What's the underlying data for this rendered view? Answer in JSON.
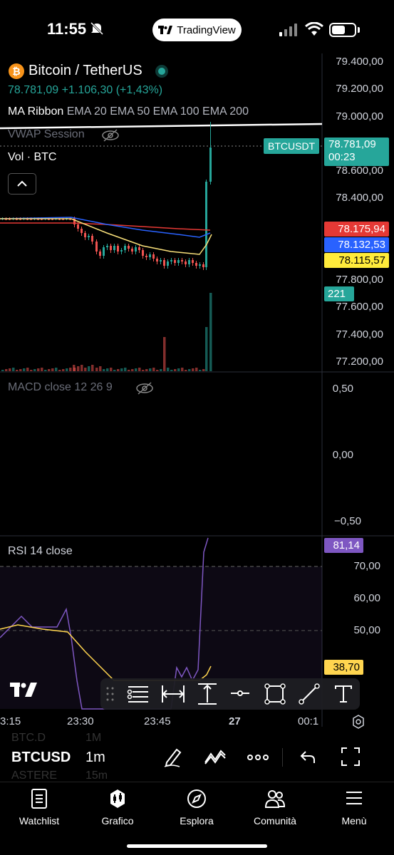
{
  "status_bar": {
    "time": "11:55",
    "app_badge": "TradingView"
  },
  "header": {
    "symbol_title": "Bitcoin / TetherUS",
    "price_line": "78.781,09 +1.106,30 (+1,43%)",
    "indicator_name": "MA Ribbon",
    "indicator_params": "EMA 20 EMA 50 EMA 100 EMA 200",
    "vwap_label": "VWAP Session",
    "vol_label": "Vol · BTC"
  },
  "price_axis": {
    "ticks": [
      "79.400,00",
      "79.200,00",
      "79.000,00",
      "78.600,00",
      "78.400,00",
      "77.800,00",
      "77.600,00",
      "77.400,00",
      "77.200,00"
    ],
    "symbol_tag": "BTCUSDT",
    "last_price": "78.781,09",
    "countdown": "00:23",
    "ma_tags": [
      {
        "value": "78.175,94",
        "color": "#e53935"
      },
      {
        "value": "78.132,53",
        "color": "#2962ff"
      },
      {
        "value": "78.115,57",
        "color": "#ffeb3b"
      }
    ],
    "volume_tag": "221"
  },
  "macd": {
    "label": "MACD close 12 26 9",
    "ticks": [
      "0,50",
      "0,00",
      "−0,50"
    ]
  },
  "rsi": {
    "label": "RSI 14 close",
    "ticks": [
      "70,00",
      "60,00",
      "50,00"
    ],
    "value_tag": "81,14",
    "ma_tag": "38,70"
  },
  "time_axis": {
    "labels": [
      "3:15",
      "23:30",
      "23:45",
      "27",
      "00:1"
    ]
  },
  "bottom_toolbar": {
    "symbol": "BTCUSD",
    "interval": "1m",
    "ghost_1": "BTC.D",
    "ghost_2": "1M",
    "ghost_3": "ASTERE",
    "ghost_4": "15m"
  },
  "tabs": [
    {
      "label": "Watchlist",
      "icon": "watchlist-icon"
    },
    {
      "label": "Grafico",
      "icon": "chart-icon"
    },
    {
      "label": "Esplora",
      "icon": "compass-icon"
    },
    {
      "label": "Comunità",
      "icon": "community-icon"
    },
    {
      "label": "Menù",
      "icon": "menu-icon"
    }
  ],
  "colors": {
    "up": "#26a69a",
    "down": "#ef5350",
    "rsi_line": "#7e57c2",
    "rsi_ma": "#ffd54f"
  }
}
